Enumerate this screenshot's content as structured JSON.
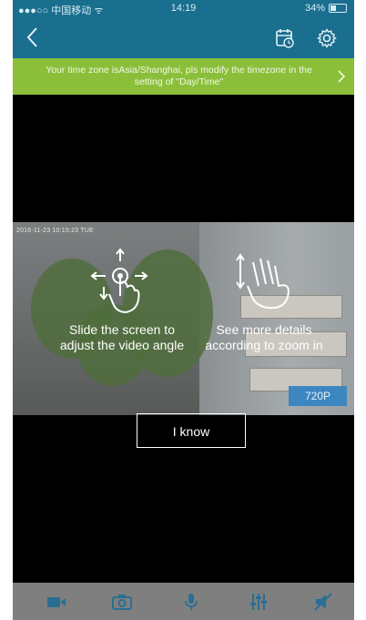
{
  "status_bar": {
    "carrier": "●●●○○ 中国移动 ᯤ",
    "time": "14:19",
    "battery": "34%"
  },
  "nav": {
    "back_icon": "chevron-left-icon",
    "playback_icon": "calendar-playback-icon",
    "settings_icon": "gear-icon"
  },
  "notice": {
    "message": "Your time zone isAsia/Shanghai, pls modify the timezone in the setting of \"Day/Time\""
  },
  "video": {
    "timestamp": "2016-11-23 10:15:23 TUE",
    "resolution": "720P"
  },
  "guide": {
    "hint_slide": "Slide the screen to adjust the video angle",
    "hint_zoom": "See more details according to zoom in",
    "confirm_label": "I know"
  },
  "toolbar": {
    "items": [
      "record-icon",
      "snapshot-camera-icon",
      "microphone-icon",
      "settings-sliders-icon",
      "speaker-muted-icon"
    ]
  },
  "colors": {
    "nav_bg": "#1a6e8e",
    "notice_bg": "#8bbf3a",
    "badge_bg": "#3d87c1",
    "toolbar_bg": "#7f7f7f"
  }
}
